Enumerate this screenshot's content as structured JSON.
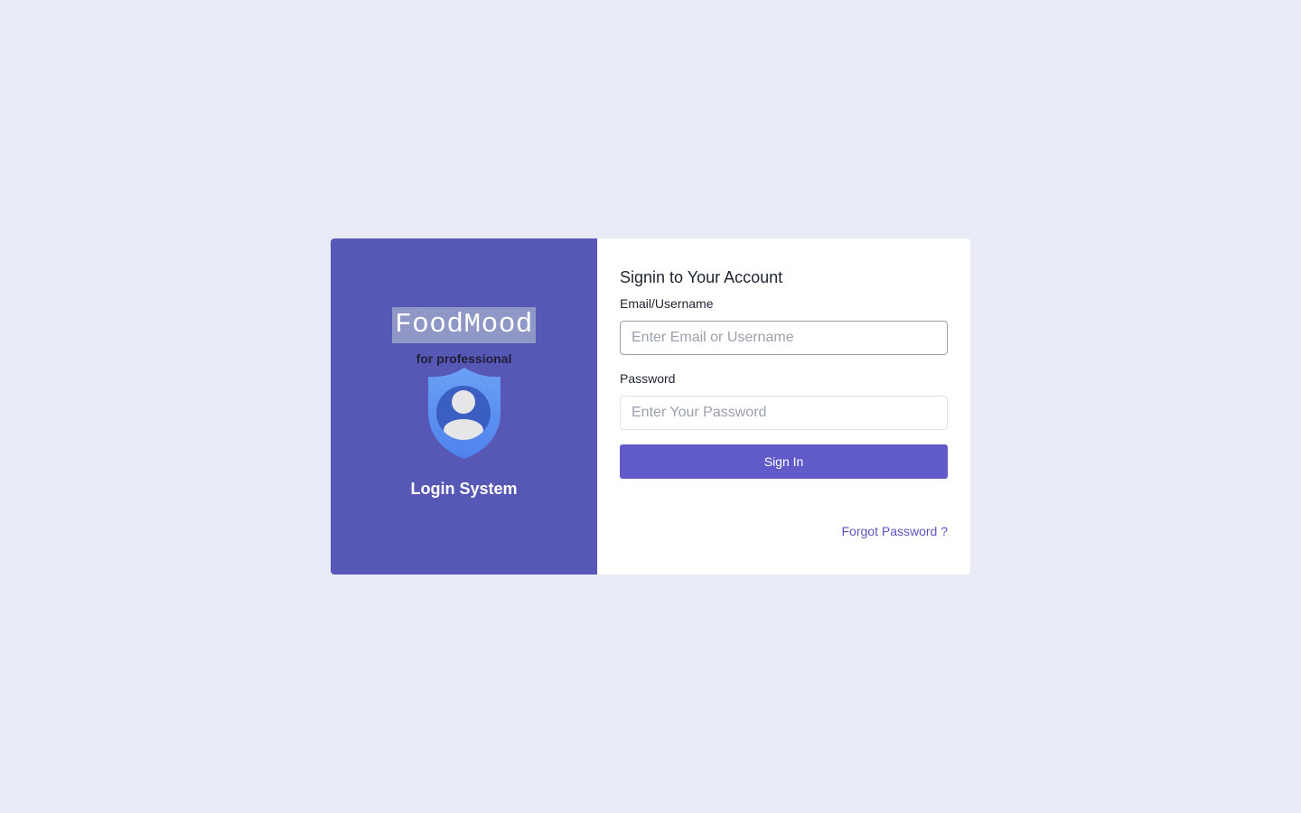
{
  "brand": {
    "logo_text": "FoodMood",
    "tagline": "for professional",
    "panel_title": "Login System",
    "icon": "shield-user-icon"
  },
  "form": {
    "title": "Signin to Your Account",
    "email_label": "Email/Username",
    "email_placeholder": "Enter Email or Username",
    "email_value": "",
    "password_label": "Password",
    "password_placeholder": "Enter Your Password",
    "password_value": "",
    "submit_label": "Sign In",
    "forgot_label": "Forgot Password ?"
  },
  "colors": {
    "page_background": "#e9ecf7",
    "brand_panel": "#5757b5",
    "logo_box": "#8e97c6",
    "primary_button": "#615bc9",
    "link": "#5b55c0"
  }
}
